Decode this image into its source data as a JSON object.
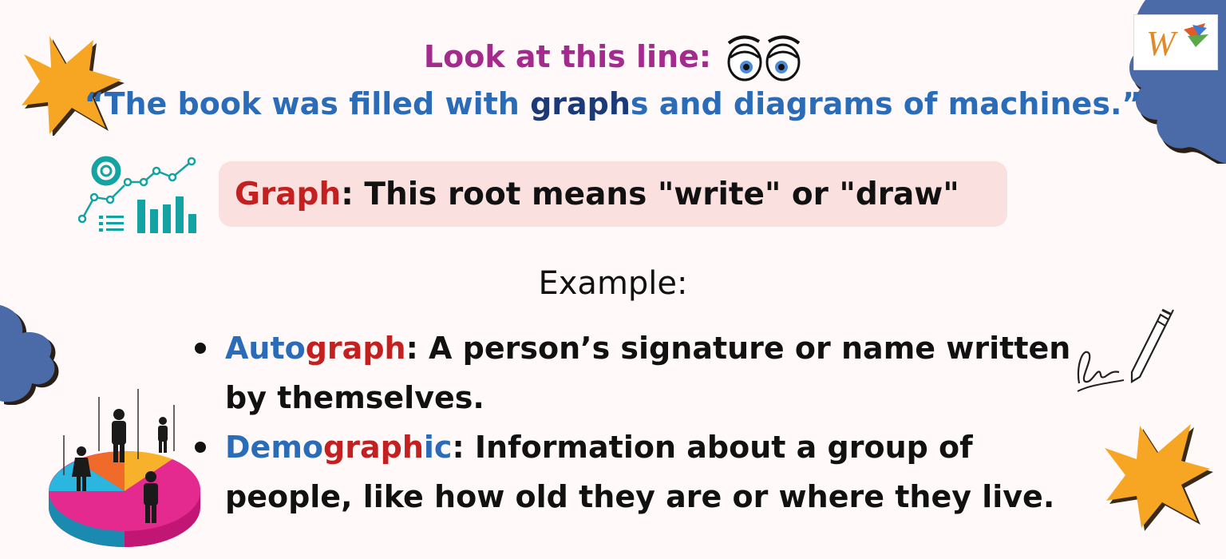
{
  "header": {
    "prompt": "Look at this line:",
    "quote_open": "“The book was filled with ",
    "quote_highlight_root": "graph",
    "quote_highlight_suffix": "s",
    "quote_close": " and diagrams of machines.”"
  },
  "root_banner": {
    "root": "Graph",
    "definition": ": This root means \"write\" or \"draw\""
  },
  "examples": {
    "label": "Example:",
    "items": [
      {
        "word_prefix": "Auto",
        "word_root": "graph",
        "word_suffix": "",
        "definition": ": A person’s signature or name written by themselves."
      },
      {
        "word_prefix": "Demo",
        "word_root": "graph",
        "word_suffix": "ic",
        "definition": ": Information about a group of people, like how old they are or where they live."
      }
    ]
  },
  "logo": {
    "mark": "W"
  },
  "colors": {
    "prompt": "#a52a8e",
    "quote": "#2b6cb8",
    "root": "#c42020",
    "banner_bg": "#fbe0e0",
    "starburst": "#f6a623",
    "blob": "#4a6aa8",
    "teal": "#14a3a3"
  },
  "icons": [
    "eyes-icon",
    "chart-icon",
    "signature-pen-icon",
    "pie-chart-people-icon",
    "starburst-decoration",
    "blob-decoration",
    "logo-badge"
  ]
}
